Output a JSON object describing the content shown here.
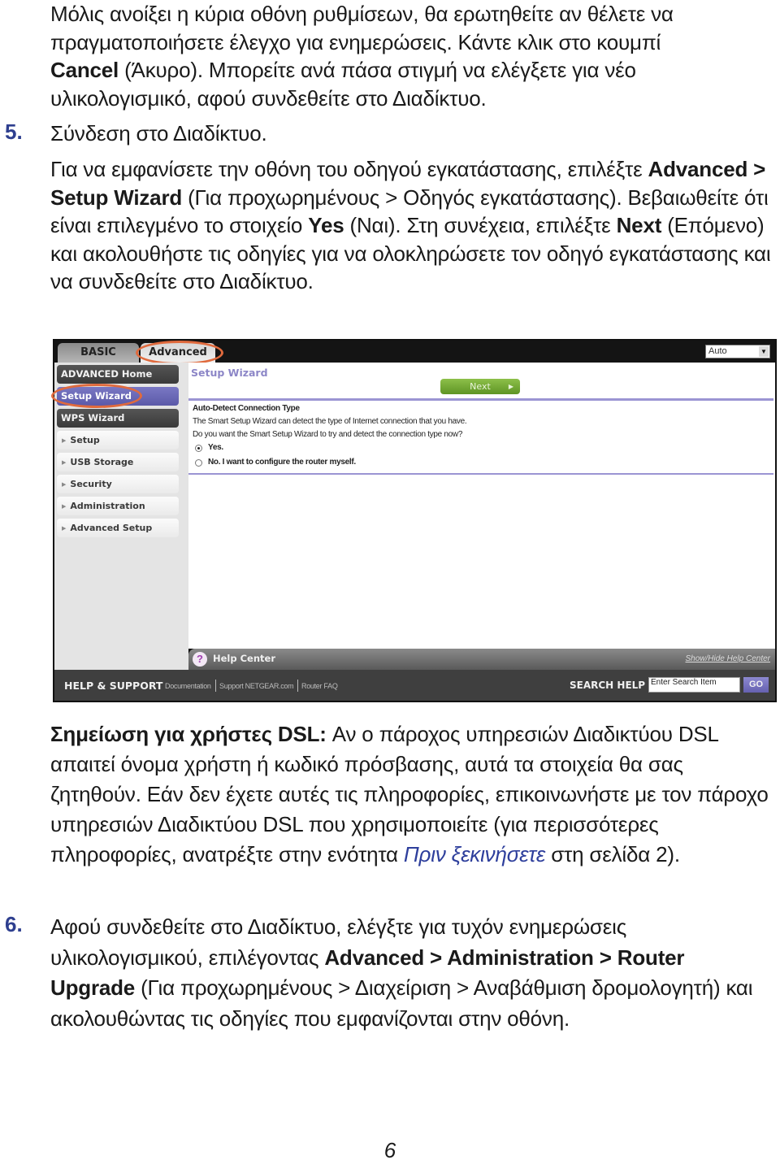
{
  "intro_paragraph": {
    "line1": "Μόλις ανοίξει η κύρια οθόνη ρυθμίσεων, θα ερωτηθείτε αν θέλετε να",
    "line2": "πραγματοποιήσετε έλεγχο για ενημερώσεις. Κάντε κλικ στο κουμπί",
    "line3_bold": "Cancel",
    "line3_rest": " (Άκυρο). Μπορείτε ανά πάσα στιγμή να ελέγξετε για νέο",
    "line4": "υλικολογισμικό, αφού συνδεθείτε στο Διαδίκτυο."
  },
  "step5": {
    "number": "5.",
    "title": "Σύνδεση στο Διαδίκτυο.",
    "body": {
      "t1": "Για να εμφανίσετε την οθόνη του οδηγού εγκατάστασης, επιλέξτε ",
      "b1": "Advanced > Setup Wizard",
      "t2": " (Για προχωρημένους > Οδηγός εγκατάστασης). Βεβαιωθείτε ότι είναι επιλεγμένο το στοιχείο ",
      "b2": "Yes",
      "t3": " (Ναι). Στη συνέχεια, επιλέξτε ",
      "b3": "Next",
      "t4": " (Επόμενο) και ακολουθήστε τις οδηγίες για να ολοκληρώσετε τον οδηγό εγκατάστασης και να συνδεθείτε στο Διαδίκτυο."
    }
  },
  "router_ui": {
    "tabs": {
      "basic": "BASIC",
      "advanced": "Advanced"
    },
    "language_select": {
      "value": "Auto"
    },
    "sidebar": {
      "items": [
        {
          "label": "ADVANCED Home",
          "style": "dark"
        },
        {
          "label": "Setup Wizard",
          "style": "active"
        },
        {
          "label": "WPS Wizard",
          "style": "dark"
        },
        {
          "label": "Setup",
          "style": "light"
        },
        {
          "label": "USB Storage",
          "style": "light"
        },
        {
          "label": "Security",
          "style": "light"
        },
        {
          "label": "Administration",
          "style": "light"
        },
        {
          "label": "Advanced Setup",
          "style": "light"
        }
      ]
    },
    "main": {
      "title": "Setup Wizard",
      "next_button": "Next",
      "section_title": "Auto-Detect Connection Type",
      "description1": "The Smart Setup Wizard can detect the type of Internet connection that you have.",
      "description2": "Do you want the Smart Setup Wizard to try and detect the connection type now?",
      "options": [
        {
          "label": "Yes.",
          "selected": true
        },
        {
          "label": "No. I want to configure the router myself.",
          "selected": false
        }
      ]
    },
    "help_center": {
      "label": "Help Center",
      "toggle_link": "Show/Hide Help Center"
    },
    "footer": {
      "title": "HELP & SUPPORT",
      "links": [
        "Documentation",
        "Support NETGEAR.com",
        "Router FAQ"
      ],
      "search_label": "SEARCH HELP",
      "search_placeholder": "Enter Search Item",
      "go_button": "GO"
    },
    "highlight_color": "#e06a3d"
  },
  "note": {
    "label": "Σημείωση για χρήστες DSL:",
    "t1": " Αν ο πάροχος υπηρεσιών Διαδικτύου DSL απαιτεί όνομα χρήστη ή κωδικό πρόσβασης, αυτά τα στοιχεία θα σας ζητηθούν. Εάν δεν έχετε αυτές τις πληροφορίες, επικοινωνήστε με τον πάροχο υπηρεσιών Διαδικτύου DSL που χρησιμοποιείτε (για περισσότερες πληροφορίες, ανατρέξτε στην ενότητα ",
    "link": "Πριν ξεκινήσετε",
    "t2": " στη σελίδα 2)."
  },
  "step6": {
    "number": "6.",
    "t1": "Αφού συνδεθείτε στο Διαδίκτυο, ελέγξτε για τυχόν ενημερώσεις υλικολογισμικού, επιλέγοντας ",
    "b1": "Advanced > Administration > Router Upgrade",
    "t2": " (Για προχωρημένους > Διαχείριση > Αναβάθμιση δρομολογητή) και ακολουθώντας τις οδηγίες που εμφανίζονται στην οθόνη."
  },
  "page_number": "6",
  "colors": {
    "step_number": "#2e3f8f",
    "link": "#2e3f9c",
    "active_nav": "#5b59a8",
    "next_button": "#6fa632"
  }
}
